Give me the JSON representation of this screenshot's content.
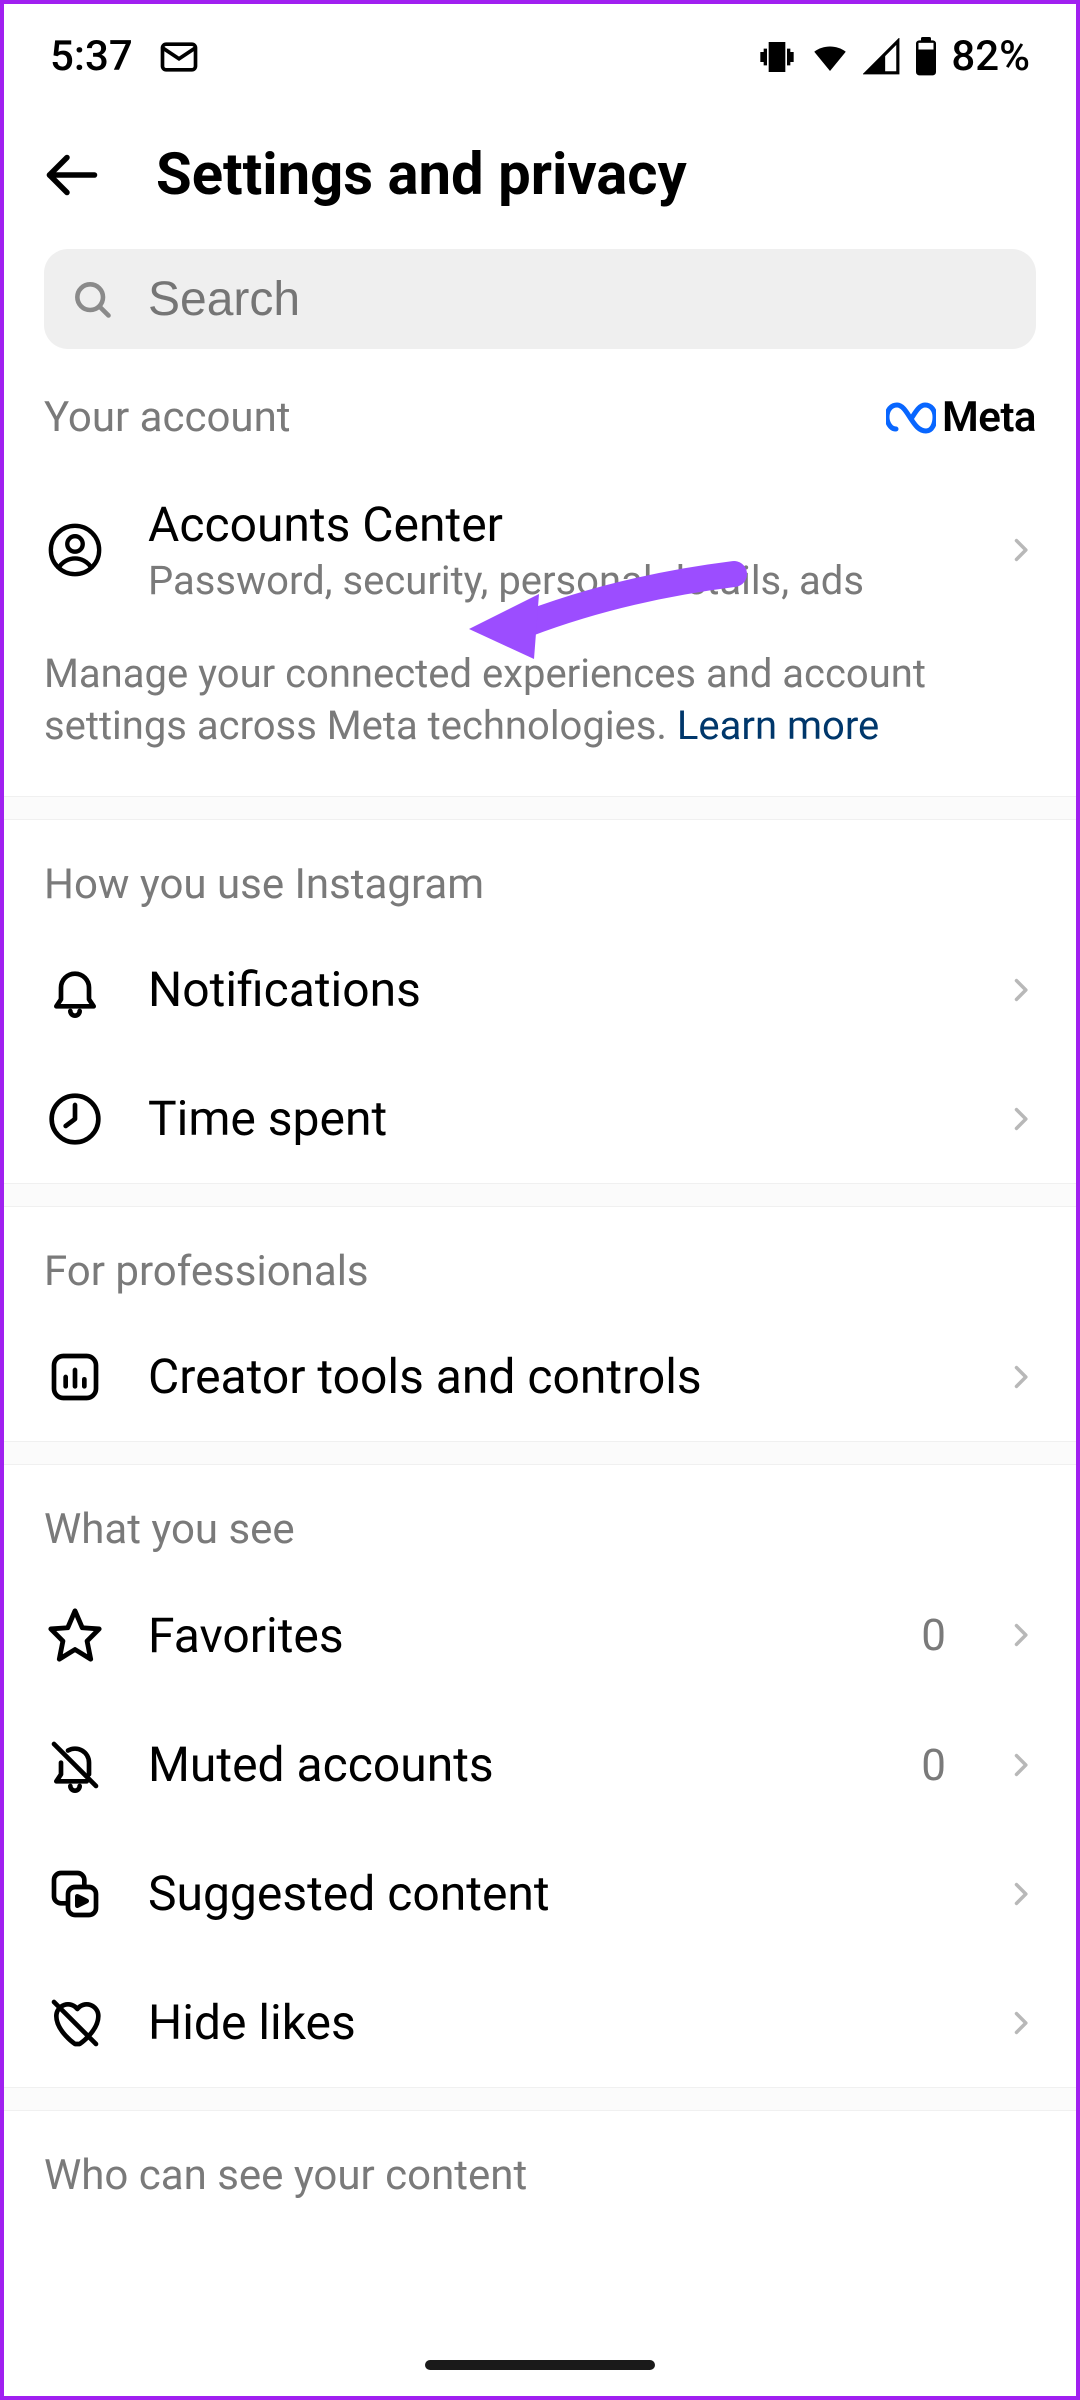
{
  "status": {
    "time": "5:37",
    "battery": "82%"
  },
  "header": {
    "title": "Settings and privacy"
  },
  "search": {
    "placeholder": "Search"
  },
  "account_section": {
    "label": "Your account",
    "brand": "Meta",
    "item_title": "Accounts Center",
    "item_subtitle": "Password, security, personal details, ads",
    "description": "Manage your connected experiences and account settings across Meta technologies. ",
    "learn_more": "Learn more"
  },
  "usage_section": {
    "label": "How you use Instagram",
    "items": [
      {
        "label": "Notifications"
      },
      {
        "label": "Time spent"
      }
    ]
  },
  "professionals_section": {
    "label": "For professionals",
    "items": [
      {
        "label": "Creator tools and controls"
      }
    ]
  },
  "see_section": {
    "label": "What you see",
    "items": [
      {
        "label": "Favorites",
        "value": "0"
      },
      {
        "label": "Muted accounts",
        "value": "0"
      },
      {
        "label": "Suggested content"
      },
      {
        "label": "Hide likes"
      }
    ]
  },
  "visibility_section": {
    "label": "Who can see your content"
  }
}
